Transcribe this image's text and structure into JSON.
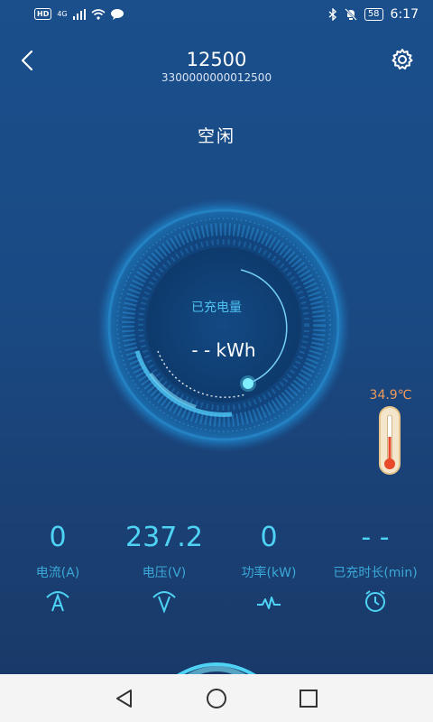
{
  "status_bar": {
    "hd": "HD",
    "network": "4G",
    "battery": "58",
    "time": "6:17"
  },
  "header": {
    "title": "12500",
    "subtitle": "3300000000012500"
  },
  "charge_status": "空闲",
  "gauge": {
    "label": "已充电量",
    "value": "- - kWh"
  },
  "temperature": "34.9℃",
  "metrics": [
    {
      "value": "0",
      "label": "电流(A)",
      "icon": "current-icon"
    },
    {
      "value": "237.2",
      "label": "电压(V)",
      "icon": "voltage-icon"
    },
    {
      "value": "0",
      "label": "功率(kW)",
      "icon": "power-icon"
    },
    {
      "value": "- -",
      "label": "已充时长(min)",
      "icon": "clock-icon"
    }
  ],
  "colors": {
    "accent": "#4fd3f5",
    "label_blue": "#3aa8d8",
    "temperature": "#f29a5a"
  }
}
